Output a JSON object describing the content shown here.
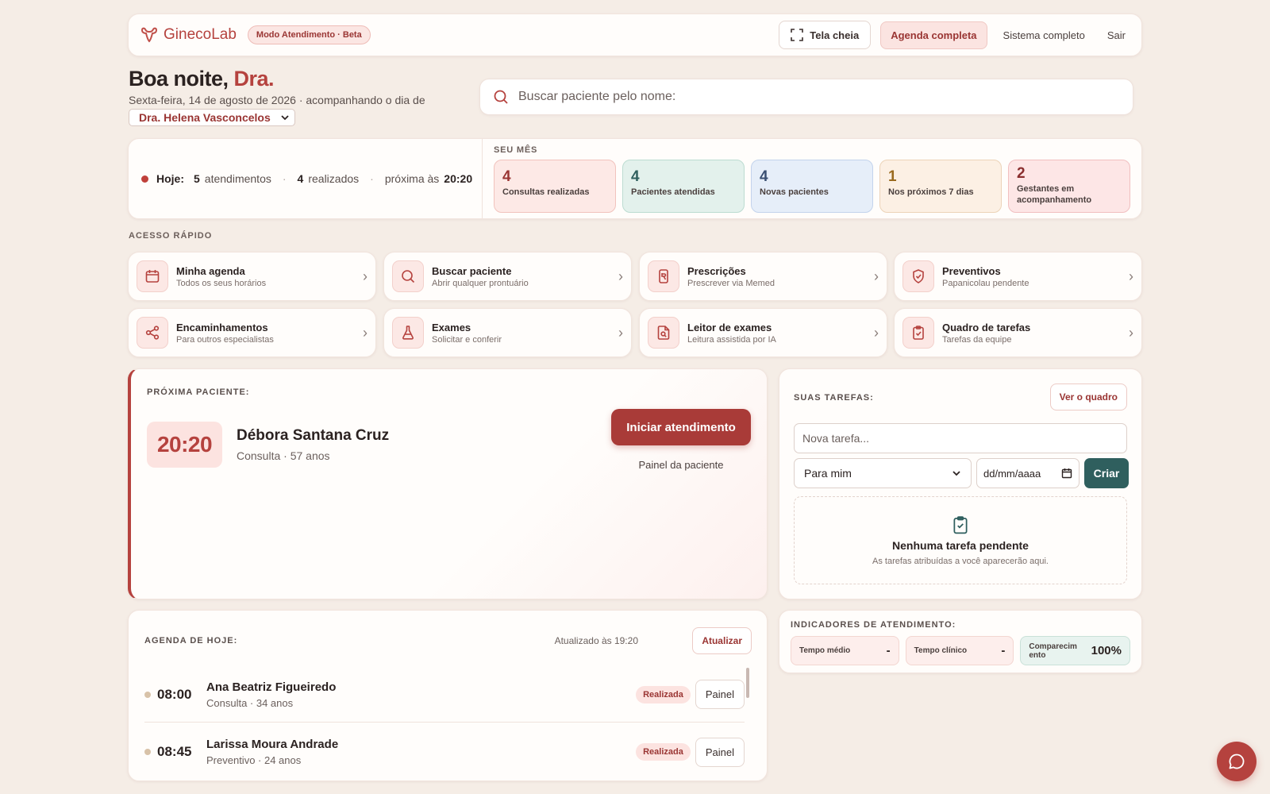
{
  "header": {
    "logo_text": "GinecoLab",
    "beta_badge": "Modo Atendimento · Beta",
    "fullscreen_label": "Tela cheia",
    "agenda_label": "Agenda completa",
    "system_label": "Sistema completo",
    "logout_label": "Sair"
  },
  "greeting": {
    "hello": "Boa noite,",
    "name": "Dra.",
    "date_line": "Sexta-feira, 14 de agosto de 2026 · acompanhando o dia de",
    "doctor_selected": "Dra. Helena Vasconcelos"
  },
  "search": {
    "placeholder": "Buscar paciente pelo nome:"
  },
  "today": {
    "label": "Hoje:",
    "count": "5",
    "count_label": "atendimentos",
    "done": "4",
    "done_label": "realizados",
    "next_label": "próxima às",
    "next_time": "20:20"
  },
  "month": {
    "label": "SEU MÊS",
    "tiles": [
      {
        "num": "4",
        "label": "Consultas realizadas"
      },
      {
        "num": "4",
        "label": "Pacientes atendidas"
      },
      {
        "num": "4",
        "label": "Novas pacientes"
      },
      {
        "num": "1",
        "label": "Nos próximos 7 dias"
      },
      {
        "num": "2",
        "label": "Gestantes em acompanhamento"
      }
    ]
  },
  "quick": {
    "label": "ACESSO RÁPIDO",
    "items": [
      {
        "title": "Minha agenda",
        "sub": "Todos os seus horários",
        "icon": "calendar-icon"
      },
      {
        "title": "Buscar paciente",
        "sub": "Abrir qualquer prontuário",
        "icon": "search-icon"
      },
      {
        "title": "Prescrições",
        "sub": "Prescrever via Memed",
        "icon": "prescription-icon"
      },
      {
        "title": "Preventivos",
        "sub": "Papanicolau pendente",
        "icon": "shield-icon"
      },
      {
        "title": "Encaminhamentos",
        "sub": "Para outros especialistas",
        "icon": "share-icon"
      },
      {
        "title": "Exames",
        "sub": "Solicitar e conferir",
        "icon": "flask-icon"
      },
      {
        "title": "Leitor de exames",
        "sub": "Leitura assistida por IA",
        "icon": "document-search-icon"
      },
      {
        "title": "Quadro de tarefas",
        "sub": "Tarefas da equipe",
        "icon": "clipboard-icon"
      }
    ]
  },
  "next_patient": {
    "label": "PRÓXIMA PACIENTE:",
    "time": "20:20",
    "name": "Débora Santana Cruz",
    "info": "Consulta · 57 anos",
    "start_label": "Iniciar atendimento",
    "panel_label": "Painel da paciente"
  },
  "tasks": {
    "label": "SUAS TAREFAS:",
    "board_label": "Ver o quadro",
    "input_placeholder": "Nova tarefa...",
    "assignee": "Para mim",
    "date_placeholder": "dd/mm/aaaa",
    "create_label": "Criar",
    "empty_title": "Nenhuma tarefa pendente",
    "empty_sub": "As tarefas atribuídas a você aparecerão aqui."
  },
  "agenda": {
    "label": "AGENDA DE HOJE:",
    "updated": "Atualizado às 19:20",
    "refresh_label": "Atualizar",
    "rows": [
      {
        "time": "08:00",
        "name": "Ana Beatriz Figueiredo",
        "info": "Consulta · 34 anos",
        "status": "Realizada",
        "panel": "Painel"
      },
      {
        "time": "08:45",
        "name": "Larissa Moura Andrade",
        "info": "Preventivo · 24 anos",
        "status": "Realizada",
        "panel": "Painel"
      }
    ]
  },
  "indicators": {
    "label": "INDICADORES DE ATENDIMENTO:",
    "items": [
      {
        "label": "Tempo médio",
        "value": "-"
      },
      {
        "label": "Tempo clínico",
        "value": "-"
      },
      {
        "label": "Comparecim ento",
        "value": "100%"
      }
    ]
  },
  "colors": {
    "accent": "#b5423e",
    "teal": "#2f5f5e"
  }
}
